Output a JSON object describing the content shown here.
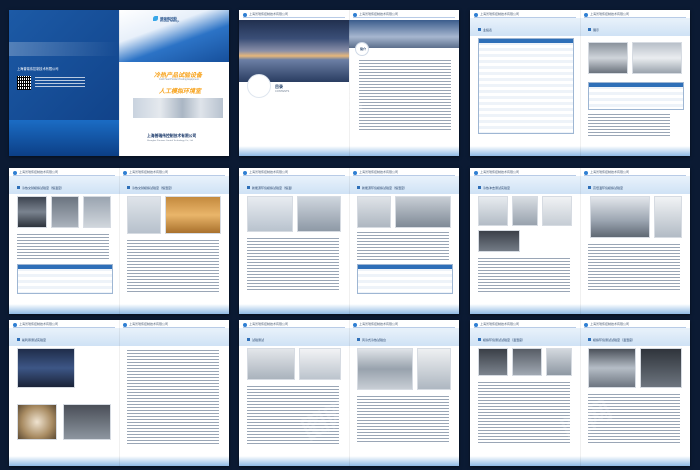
{
  "cover": {
    "brand_name": "普瑞伟控股",
    "brand_sub": "Puruiwei Holdings",
    "company_small": "上海普瑞伟控制技术有限公司",
    "title_line1": "冷热产品试验设备",
    "title_line2": "人工模拟环境室",
    "subtitle_en": "Cold Heat Product Testing Equipment",
    "company_bottom": "上海普瑞伟控制技术有限公司",
    "company_bottom_en": "Shanghai Puruiwei Control Technology Co., Ltd"
  },
  "contents": {
    "label_cn": "目录",
    "label_en": "CONTENTS"
  },
  "intro": {
    "label": "简介"
  },
  "page_header": "上海普瑞伟控制技术有限公司",
  "section_titles": {
    "s3_left": "业绩表",
    "s3_right": "展示",
    "s4_left": "冷热交替模拟试验室（恒温室）",
    "s4_right": "冷热交替模拟试验室（恒湿室）",
    "s5_left": "新能源环境模拟试验室（恒温）",
    "s5_right": "新能源环境模拟试验室（恒湿室）",
    "s6_left": "冷热冲击测试实验室",
    "s6_right": "高低温环境模拟试验室",
    "s7_left": "氟利昂测试实验室",
    "s7_right": "试验测试",
    "s8_left": "风冷式冷热试验台",
    "s9_left": "模拟环境测试试验室（温湿度）",
    "s9_right": "模拟环境测试试验室（温湿度）"
  },
  "watermark": "图网",
  "colors": {
    "background": "#0b1a33",
    "accent_blue": "#2e6fb8",
    "cover_blue": "#1c5aa6",
    "cover_orange": "#f7a21b"
  }
}
